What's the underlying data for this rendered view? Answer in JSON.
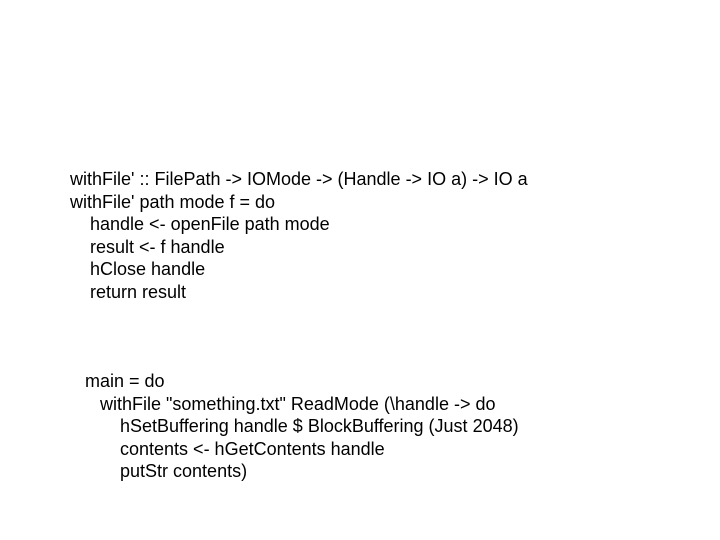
{
  "code1": {
    "l1": "withFile' :: FilePath -> IOMode -> (Handle -> IO a) -> IO a",
    "l2": "withFile' path mode f = do",
    "l3": "    handle <- openFile path mode",
    "l4": "    result <- f handle",
    "l5": "    hClose handle",
    "l6": "    return result"
  },
  "code2": {
    "l1": " main = do",
    "l2": "    withFile \"something.txt\" ReadMode (\\handle -> do",
    "l3": "        hSetBuffering handle $ BlockBuffering (Just 2048)",
    "l4": "        contents <- hGetContents handle",
    "l5": "        putStr contents)"
  }
}
